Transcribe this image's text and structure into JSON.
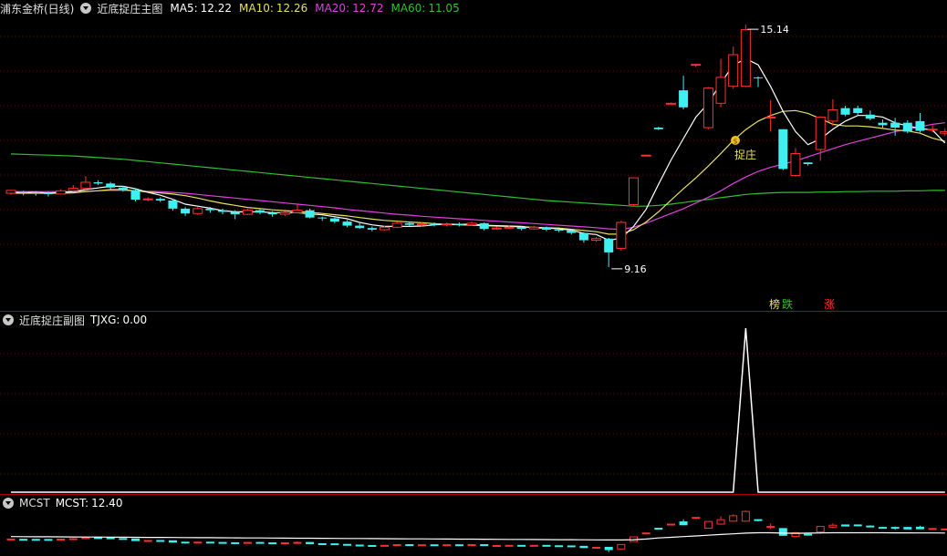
{
  "colors": {
    "ma5": "#ffffff",
    "ma10": "#e8e060",
    "ma20": "#e040e0",
    "ma60": "#30c030",
    "up": "#ff3030",
    "down": "#40f0f0",
    "grid": "#7a0000"
  },
  "main": {
    "stock": "浦东金桥(日线)",
    "indicator": "近底捉庄主图",
    "ma5": {
      "label": "MA5:",
      "value": "12.22"
    },
    "ma10": {
      "label": "MA10:",
      "value": "12.26"
    },
    "ma20": {
      "label": "MA20:",
      "value": "12.72"
    },
    "ma60": {
      "label": "MA60:",
      "value": "11.05"
    },
    "high_label": "15.14",
    "low_label": "9.16",
    "signal_icon": "money-bag-icon",
    "signal_text": "捉庄",
    "tags": [
      "榜",
      "跌",
      "涨"
    ]
  },
  "sub": {
    "title": "近底捉庄副图",
    "tjxg": {
      "label": "TJXG:",
      "value": "0.00"
    }
  },
  "mcst": {
    "name": "MCST",
    "label": "MCST:",
    "value": "12.40"
  },
  "chart_data": {
    "type": "candlestick",
    "low": 9.16,
    "high": 15.14,
    "candles": [
      [
        10.98,
        11.05,
        10.94,
        11.01
      ],
      [
        11.01,
        11.0,
        10.93,
        11.04
      ],
      [
        11.0,
        10.99,
        10.92,
        11.03
      ],
      [
        10.99,
        10.96,
        10.9,
        11.02
      ],
      [
        10.96,
        11.04,
        10.95,
        11.08
      ],
      [
        11.04,
        11.1,
        11.02,
        11.18
      ],
      [
        11.1,
        11.25,
        11.05,
        11.4
      ],
      [
        11.25,
        11.22,
        11.18,
        11.3
      ],
      [
        11.22,
        11.12,
        11.08,
        11.26
      ],
      [
        11.12,
        11.06,
        11.02,
        11.16
      ],
      [
        11.06,
        10.82,
        10.78,
        11.1
      ],
      [
        10.82,
        10.84,
        10.78,
        10.88
      ],
      [
        10.84,
        10.8,
        10.76,
        10.88
      ],
      [
        10.8,
        10.6,
        10.55,
        10.84
      ],
      [
        10.6,
        10.48,
        10.42,
        10.64
      ],
      [
        10.48,
        10.6,
        10.45,
        10.64
      ],
      [
        10.6,
        10.56,
        10.5,
        10.64
      ],
      [
        10.56,
        10.52,
        10.46,
        10.6
      ],
      [
        10.52,
        10.46,
        10.34,
        10.56
      ],
      [
        10.46,
        10.56,
        10.44,
        10.6
      ],
      [
        10.56,
        10.5,
        10.46,
        10.6
      ],
      [
        10.5,
        10.46,
        10.4,
        10.54
      ],
      [
        10.46,
        10.5,
        10.42,
        10.54
      ],
      [
        10.5,
        10.56,
        10.48,
        10.7
      ],
      [
        10.56,
        10.38,
        10.36,
        10.6
      ],
      [
        10.38,
        10.36,
        10.3,
        10.4
      ],
      [
        10.36,
        10.28,
        10.24,
        10.38
      ],
      [
        10.28,
        10.18,
        10.14,
        10.32
      ],
      [
        10.18,
        10.12,
        10.1,
        10.24
      ],
      [
        10.12,
        10.08,
        10.04,
        10.16
      ],
      [
        10.08,
        10.14,
        10.06,
        10.18
      ],
      [
        10.14,
        10.24,
        10.12,
        10.28
      ],
      [
        10.24,
        10.2,
        10.16,
        10.28
      ],
      [
        10.2,
        10.22,
        10.16,
        10.26
      ],
      [
        10.22,
        10.2,
        10.16,
        10.26
      ],
      [
        10.2,
        10.22,
        10.16,
        10.26
      ],
      [
        10.22,
        10.2,
        10.16,
        10.26
      ],
      [
        10.2,
        10.24,
        10.18,
        10.28
      ],
      [
        10.24,
        10.1,
        10.06,
        10.26
      ],
      [
        10.1,
        10.12,
        10.08,
        10.16
      ],
      [
        10.12,
        10.14,
        10.1,
        10.18
      ],
      [
        10.14,
        10.1,
        10.06,
        10.16
      ],
      [
        10.1,
        10.14,
        10.08,
        10.18
      ],
      [
        10.14,
        10.08,
        10.04,
        10.16
      ],
      [
        10.08,
        10.06,
        10.02,
        10.1
      ],
      [
        10.06,
        10.0,
        9.96,
        10.08
      ],
      [
        10.0,
        9.82,
        9.76,
        10.02
      ],
      [
        9.82,
        9.86,
        9.78,
        9.9
      ],
      [
        9.86,
        9.52,
        9.16,
        9.88
      ],
      [
        9.62,
        10.26,
        9.56,
        10.3
      ],
      [
        10.7,
        11.36,
        10.66,
        11.36
      ],
      [
        11.92,
        11.92,
        11.9,
        11.92
      ],
      [
        12.6,
        12.56,
        12.54,
        12.62
      ],
      [
        13.2,
        13.2,
        13.18,
        13.22
      ],
      [
        13.52,
        13.1,
        13.05,
        13.88
      ],
      [
        14.14,
        14.16,
        14.1,
        14.18
      ],
      [
        12.6,
        13.58,
        12.56,
        13.6
      ],
      [
        13.2,
        13.84,
        13.1,
        14.3
      ],
      [
        13.62,
        14.4,
        13.56,
        14.6
      ],
      [
        13.62,
        15.02,
        13.6,
        15.14
      ],
      [
        13.84,
        13.82,
        13.6,
        13.86
      ],
      [
        12.84,
        12.86,
        12.5,
        13.28
      ],
      [
        12.56,
        11.58,
        11.55,
        12.56
      ],
      [
        11.42,
        11.96,
        11.38,
        12.1
      ],
      [
        11.74,
        11.7,
        11.66,
        11.72
      ],
      [
        12.06,
        12.86,
        11.78,
        12.88
      ],
      [
        12.76,
        13.04,
        12.64,
        13.3
      ],
      [
        13.08,
        12.92,
        12.88,
        13.14
      ],
      [
        13.08,
        12.96,
        12.9,
        13.14
      ],
      [
        12.92,
        12.82,
        12.78,
        13.02
      ],
      [
        12.72,
        12.66,
        12.6,
        12.8
      ],
      [
        12.72,
        12.6,
        12.4,
        12.84
      ],
      [
        12.72,
        12.5,
        12.46,
        12.78
      ],
      [
        12.76,
        12.52,
        12.48,
        12.96
      ],
      [
        12.54,
        12.56,
        12.48,
        12.66
      ],
      [
        12.46,
        12.5,
        12.4,
        12.58
      ]
    ],
    "ma5": [
      11.0,
      11.0,
      11.0,
      10.99,
      11.0,
      11.02,
      11.07,
      11.11,
      11.15,
      11.15,
      11.09,
      11.0,
      10.93,
      10.83,
      10.71,
      10.66,
      10.61,
      10.55,
      10.52,
      10.52,
      10.52,
      10.5,
      10.5,
      10.5,
      10.47,
      10.45,
      10.4,
      10.35,
      10.26,
      10.2,
      10.16,
      10.16,
      10.16,
      10.17,
      10.2,
      10.22,
      10.21,
      10.22,
      10.19,
      10.18,
      10.17,
      10.16,
      10.12,
      10.12,
      10.1,
      10.07,
      9.99,
      9.96,
      9.82,
      9.87,
      10.16,
      10.58,
      11.2,
      11.8,
      12.33,
      12.86,
      13.2,
      13.7,
      14.14,
      14.3,
      14.15,
      13.62,
      13.0,
      12.5,
      12.18,
      12.32,
      12.56,
      12.76,
      12.9,
      12.9,
      12.86,
      12.72,
      12.64,
      12.58,
      12.54,
      12.22
    ],
    "ma10": [
      10.98,
      10.98,
      10.98,
      10.98,
      10.98,
      10.99,
      11.02,
      11.04,
      11.07,
      11.07,
      11.04,
      11.01,
      10.99,
      10.96,
      10.92,
      10.86,
      10.79,
      10.73,
      10.68,
      10.63,
      10.6,
      10.57,
      10.55,
      10.53,
      10.51,
      10.48,
      10.45,
      10.42,
      10.38,
      10.34,
      10.31,
      10.29,
      10.27,
      10.25,
      10.23,
      10.21,
      10.2,
      10.19,
      10.18,
      10.17,
      10.16,
      10.15,
      10.14,
      10.13,
      10.12,
      10.09,
      10.06,
      10.03,
      9.97,
      9.97,
      10.08,
      10.27,
      10.52,
      10.81,
      11.09,
      11.36,
      11.65,
      11.96,
      12.28,
      12.55,
      12.76,
      12.9,
      13.0,
      13.02,
      12.95,
      12.82,
      12.68,
      12.64,
      12.64,
      12.62,
      12.58,
      12.54,
      12.52,
      12.46,
      12.34,
      12.26
    ],
    "ma20": [
      11.02,
      11.02,
      11.02,
      11.02,
      11.02,
      11.02,
      11.03,
      11.04,
      11.05,
      11.05,
      11.04,
      11.03,
      11.02,
      11.0,
      10.98,
      10.95,
      10.92,
      10.89,
      10.86,
      10.83,
      10.8,
      10.77,
      10.74,
      10.71,
      10.68,
      10.65,
      10.62,
      10.58,
      10.55,
      10.52,
      10.49,
      10.46,
      10.44,
      10.41,
      10.39,
      10.37,
      10.35,
      10.33,
      10.31,
      10.29,
      10.27,
      10.25,
      10.23,
      10.21,
      10.19,
      10.17,
      10.15,
      10.13,
      10.1,
      10.09,
      10.14,
      10.24,
      10.36,
      10.48,
      10.6,
      10.74,
      10.88,
      11.04,
      11.22,
      11.38,
      11.52,
      11.62,
      11.7,
      11.78,
      11.88,
      11.98,
      12.08,
      12.18,
      12.26,
      12.34,
      12.42,
      12.5,
      12.56,
      12.62,
      12.68,
      12.72
    ],
    "ma60": [
      11.95,
      11.94,
      11.93,
      11.92,
      11.91,
      11.9,
      11.88,
      11.86,
      11.84,
      11.82,
      11.79,
      11.76,
      11.73,
      11.7,
      11.67,
      11.64,
      11.61,
      11.58,
      11.55,
      11.52,
      11.49,
      11.46,
      11.43,
      11.4,
      11.37,
      11.34,
      11.31,
      11.28,
      11.25,
      11.22,
      11.19,
      11.16,
      11.13,
      11.1,
      11.07,
      11.04,
      11.01,
      10.98,
      10.95,
      10.92,
      10.89,
      10.86,
      10.83,
      10.8,
      10.78,
      10.76,
      10.74,
      10.72,
      10.7,
      10.68,
      10.66,
      10.66,
      10.68,
      10.71,
      10.75,
      10.79,
      10.83,
      10.87,
      10.91,
      10.95,
      10.97,
      10.99,
      11.0,
      11.0,
      11.0,
      11.01,
      11.01,
      11.02,
      11.02,
      11.03,
      11.03,
      11.03,
      11.04,
      11.04,
      11.05,
      11.05
    ],
    "tjxg_peak_index": 59,
    "mcst_line": [
      11.4,
      11.39,
      11.38,
      11.37,
      11.36,
      11.35,
      11.34,
      11.33,
      11.32,
      11.31,
      11.3,
      11.29,
      11.28,
      11.27,
      11.26,
      11.25,
      11.24,
      11.23,
      11.22,
      11.21,
      11.2,
      11.19,
      11.18,
      11.17,
      11.16,
      11.15,
      11.14,
      11.13,
      11.12,
      11.11,
      11.1,
      11.09,
      11.08,
      11.07,
      11.06,
      11.05,
      11.04,
      11.03,
      11.02,
      11.01,
      11.0,
      10.99,
      10.98,
      10.97,
      10.96,
      10.95,
      10.94,
      10.93,
      10.92,
      10.91,
      10.95,
      11.05,
      11.2,
      11.3,
      11.4,
      11.5,
      11.6,
      11.7,
      11.8,
      11.9,
      11.95,
      11.95,
      11.9,
      11.88,
      11.9,
      11.93,
      11.95,
      11.95,
      11.95,
      11.95,
      11.95,
      11.94,
      11.94,
      11.93,
      11.93,
      11.92
    ]
  }
}
